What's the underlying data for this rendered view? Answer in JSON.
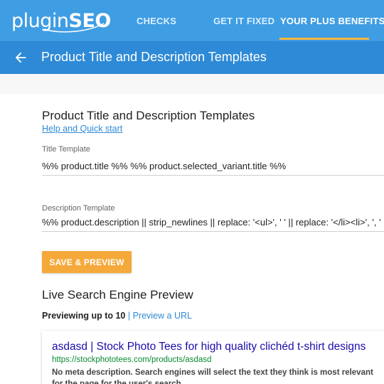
{
  "nav": {
    "logo_part1": "plugin",
    "logo_part2": "SEO",
    "links": [
      "CHECKS",
      "GET IT FIXED",
      "YOUR PLUS BENEFITS"
    ],
    "active_index": 2,
    "bg_color": "#3f9de3",
    "accent_color": "#f7b53e"
  },
  "titlebar": {
    "title": "Product Title and Description Templates",
    "back_icon": "arrow-left-icon"
  },
  "form": {
    "heading": "Product Title and Description Templates",
    "help_link": "Help and Quick start",
    "title_label": "Title Template",
    "title_value": "%% product.title %% %% product.selected_variant.title %%",
    "description_label": "Description Template",
    "description_value": "%% product.description || strip_newlines || replace: '<ul>', ' ' || replace: '</li><li>', ', ' || replace: '</li>', '' || strip_html %%",
    "save_button": "SAVE & PREVIEW",
    "save_color": "#f5a93b"
  },
  "preview": {
    "heading": "Live Search Engine Preview",
    "previewing_label": "Previewing up to 10",
    "separator": "|",
    "url_link": "Preview a URL",
    "result": {
      "title": "asdasd | Stock Photo Tees for high quality clichéd t-shirt designs",
      "url": "https://stockphototees.com/products/asdasd",
      "description": "No meta description. Search engines will select the text they think is most relevant for the page for the user's search."
    }
  }
}
